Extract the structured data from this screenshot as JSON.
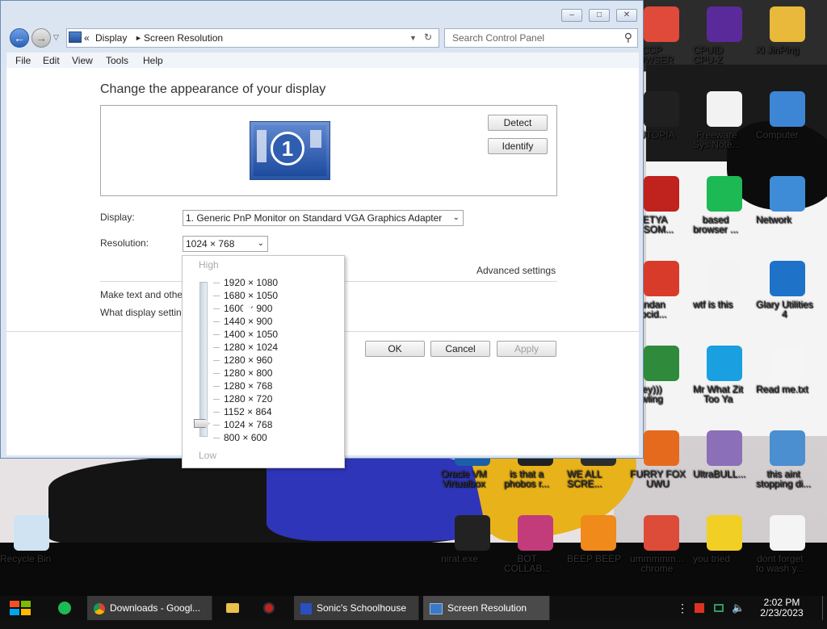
{
  "window": {
    "breadcrumb": [
      "Display",
      "Screen Resolution"
    ],
    "breadcrumb_prefix": "«",
    "search_placeholder": "Search Control Panel",
    "menu": [
      "File",
      "Edit",
      "View",
      "Tools",
      "Help"
    ],
    "heading": "Change the appearance of your display",
    "monitor_number": "1",
    "detect_label": "Detect",
    "identify_label": "Identify",
    "display_label": "Display:",
    "display_value": "1. Generic PnP Monitor on Standard VGA Graphics Adapter",
    "resolution_label": "Resolution:",
    "resolution_value": "1024 × 768",
    "advanced_settings": "Advanced settings",
    "make_text_partial": "Make text and othe",
    "what_display_partial": "What display settin",
    "ok_label": "OK",
    "cancel_label": "Cancel",
    "apply_label": "Apply",
    "minimize": "–",
    "maximize": "□",
    "close": "✕"
  },
  "resolution_popup": {
    "high_label": "High",
    "low_label": "Low",
    "options": [
      "1920 × 1080",
      "1680 × 1050",
      "1600 × 900",
      "1440 × 900",
      "1400 × 1050",
      "1280 × 1024",
      "1280 × 960",
      "1280 × 800",
      "1280 × 768",
      "1280 × 720",
      "1152 × 864",
      "1024 × 768",
      "800 × 600"
    ],
    "selected": "1024 × 768"
  },
  "desktop_icons": [
    {
      "label": "CCP\nROWSER",
      "color": "#e04a3a"
    },
    {
      "label": "CPUID\nCPU-Z",
      "color": "#5b2a9a"
    },
    {
      "label": "Xi JinPing",
      "color": "#e8b93a"
    },
    {
      "label": "P UTOPIA",
      "color": "#202020"
    },
    {
      "label": "Freeware\nSys Note...",
      "color": "#f2f2f2"
    },
    {
      "label": "Computer",
      "color": "#3d86d6"
    },
    {
      "label": "PETYA\nANSOM...",
      "color": "#c0221d"
    },
    {
      "label": "based\nbrowser ...",
      "color": "#1db954"
    },
    {
      "label": "Network",
      "color": "#3e8cd8"
    },
    {
      "label": "wandan\nenocid...",
      "color": "#d93b2b"
    },
    {
      "label": "wtf is this",
      "color": "#f3f3f3"
    },
    {
      "label": "Glary Utilities\n4",
      "color": "#1e73c9"
    },
    {
      "label": "(they)))\nbowling",
      "color": "#2f8a3b"
    },
    {
      "label": "Mr What Zit\nToo Ya",
      "color": "#1aa0e0"
    },
    {
      "label": "Read me.txt",
      "color": "#f5f5f5"
    },
    {
      "label": "Oracle VM\nVirtualbox",
      "color": "#1b5fa8"
    },
    {
      "label": "is that a\nphobos r...",
      "color": "#222"
    },
    {
      "label": "WE ALL\nSCRE...",
      "color": "#2d2d2d"
    },
    {
      "label": "FURRY FOX\nUWU",
      "color": "#e66a1e"
    },
    {
      "label": "UltraBULL...",
      "color": "#8b6fb8"
    },
    {
      "label": "this aint\nstopping di...",
      "color": "#4b8fd0"
    },
    {
      "label": "Recycle Bin",
      "color": "#cfe3f2"
    },
    {
      "label": "nirat.exe",
      "color": "#222"
    },
    {
      "label": "BOT\nCOLLAB...",
      "color": "#c23b7a"
    },
    {
      "label": "BEEP BEEP",
      "color": "#f08a1a"
    },
    {
      "label": "ummmmm...\nchrome",
      "color": "#dd4b39"
    },
    {
      "label": "you tried",
      "color": "#f2cf24"
    },
    {
      "label": "dont forget\nto wash y...",
      "color": "#f4f4f4"
    }
  ],
  "taskbar": {
    "tasks": [
      {
        "label": "Downloads - Googl..."
      },
      {
        "label": "Sonic's Schoolhouse"
      },
      {
        "label": "Screen Resolution"
      }
    ],
    "time": "2:02 PM",
    "date": "2/23/2023"
  }
}
